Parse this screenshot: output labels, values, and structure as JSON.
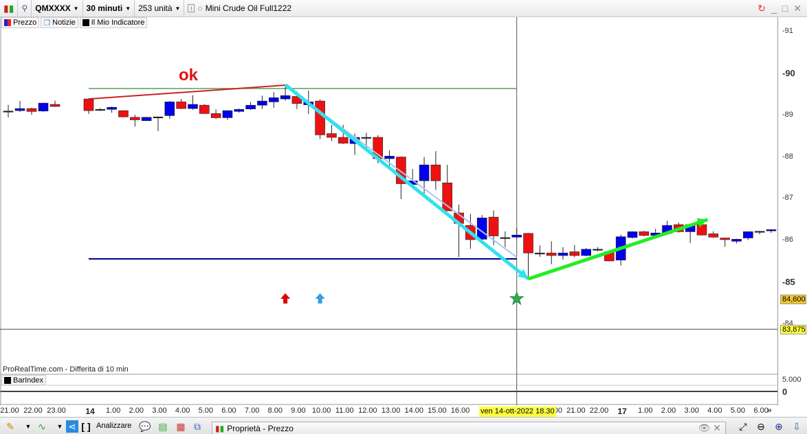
{
  "toolbar": {
    "symbol": "QMXXXX",
    "timeframe": "30 minuti",
    "units": "253 unità",
    "instrument_name": "Mini Crude Oil Full1222",
    "window_controls": [
      "refresh-icon",
      "minimize-icon",
      "maximize-icon",
      "close-icon"
    ]
  },
  "legend": {
    "items": [
      {
        "label": "Prezzo",
        "icon": "price-swatch-icon"
      },
      {
        "label": "Notizie",
        "icon": "news-icon"
      },
      {
        "label": "Il Mio Indicatore",
        "icon": "indicator-swatch-icon"
      }
    ]
  },
  "annotation_text": "ok",
  "source_note": "ProRealTime.com - Differita di 10 min",
  "indicator_panel": {
    "label": "BarIndex",
    "ticks": [
      "5.000",
      "0"
    ]
  },
  "price_axis": {
    "ticks": [
      "91",
      "90",
      "89",
      "88",
      "87",
      "86",
      "85",
      "84"
    ],
    "bold_ticks": [
      "90",
      "85"
    ],
    "last_price_tag": "84,600",
    "cursor_price_tag": "83,875"
  },
  "time_axis": {
    "labels": [
      "21.00",
      "22.00",
      "23.00",
      "14",
      "1.00",
      "2.00",
      "3.00",
      "4.00",
      "5.00",
      "6.00",
      "7.00",
      "8.00",
      "9.00",
      "10.00",
      "11.00",
      "12.00",
      "13.00",
      "14.00",
      "15.00",
      "16.00",
      "17",
      "20.00",
      "21.00",
      "22.00",
      "17",
      "1.00",
      "2.00",
      "3.00",
      "4.00",
      "5.00",
      "6.00"
    ],
    "day_labels": [
      "14",
      "17"
    ],
    "cursor_tooltip": "ven 14-ott-2022 18.30",
    "more": "»"
  },
  "bottom_toolbar": {
    "analyze_label": "Analizzare",
    "properties_panel_title": "Proprietà - Prezzo"
  },
  "colors": {
    "up": "#0000ee",
    "down": "#ee1111",
    "cyan_arrow": "#33e0f0",
    "green_arrow": "#22ee22",
    "support": "#00008b",
    "resistance": "#5aa05a"
  },
  "chart_data": {
    "type": "candlestick",
    "ylim": [
      83.5,
      91.3
    ],
    "candles_ohlc": [
      [
        89.1,
        89.25,
        88.95,
        89.1
      ],
      [
        89.11,
        89.34,
        89.08,
        89.16
      ],
      [
        89.16,
        89.18,
        89.01,
        89.09
      ],
      [
        89.1,
        89.3,
        89.08,
        89.29
      ],
      [
        89.26,
        89.35,
        89.2,
        89.21
      ],
      [
        89.39,
        89.4,
        89.03,
        89.11
      ],
      [
        89.14,
        89.17,
        89.1,
        89.14
      ],
      [
        89.14,
        89.21,
        89.06,
        89.19
      ],
      [
        89.11,
        89.12,
        88.95,
        88.96
      ],
      [
        88.95,
        89.01,
        88.73,
        88.89
      ],
      [
        88.87,
        88.96,
        88.86,
        88.95
      ],
      [
        88.96,
        88.97,
        88.62,
        88.96
      ],
      [
        88.99,
        89.34,
        88.91,
        89.32
      ],
      [
        89.32,
        89.39,
        89.15,
        89.16
      ],
      [
        89.16,
        89.48,
        89.13,
        89.26
      ],
      [
        89.24,
        89.27,
        89.03,
        89.04
      ],
      [
        89.04,
        89.14,
        88.91,
        88.94
      ],
      [
        88.94,
        89.12,
        88.89,
        89.11
      ],
      [
        89.09,
        89.16,
        89.06,
        89.14
      ],
      [
        89.15,
        89.32,
        89.13,
        89.24
      ],
      [
        89.24,
        89.47,
        89.15,
        89.34
      ],
      [
        89.32,
        89.55,
        89.18,
        89.42
      ],
      [
        89.39,
        89.71,
        89.35,
        89.47
      ],
      [
        89.45,
        89.57,
        89.15,
        89.28
      ],
      [
        89.25,
        89.59,
        89.03,
        89.32
      ],
      [
        89.34,
        89.38,
        88.43,
        88.53
      ],
      [
        88.56,
        88.77,
        88.38,
        88.47
      ],
      [
        88.47,
        88.77,
        88.31,
        88.33
      ],
      [
        88.32,
        88.56,
        88.05,
        88.47
      ],
      [
        88.47,
        88.58,
        88.22,
        88.47
      ],
      [
        88.47,
        88.52,
        87.85,
        87.96
      ],
      [
        87.96,
        88.16,
        87.78,
        88.02
      ],
      [
        88.0,
        88.01,
        86.99,
        87.36
      ],
      [
        87.34,
        87.71,
        87.3,
        87.43
      ],
      [
        87.43,
        88.0,
        87.12,
        87.81
      ],
      [
        87.81,
        88.14,
        87.21,
        87.43
      ],
      [
        87.38,
        87.81,
        86.7,
        86.71
      ],
      [
        86.66,
        86.86,
        85.6,
        86.41
      ],
      [
        86.36,
        86.64,
        85.8,
        86.02
      ],
      [
        86.03,
        86.61,
        85.98,
        86.54
      ],
      [
        86.56,
        86.72,
        85.89,
        86.11
      ],
      [
        86.07,
        86.22,
        85.84,
        86.07
      ],
      [
        86.08,
        86.29,
        86.05,
        86.13
      ],
      [
        86.17,
        86.18,
        85.07,
        85.7
      ],
      [
        85.7,
        85.88,
        85.61,
        85.7
      ],
      [
        85.7,
        85.98,
        85.43,
        85.64
      ],
      [
        85.64,
        85.84,
        85.54,
        85.7
      ],
      [
        85.73,
        85.89,
        85.6,
        85.64
      ],
      [
        85.64,
        85.82,
        85.62,
        85.79
      ],
      [
        85.79,
        85.84,
        85.74,
        85.79
      ],
      [
        85.73,
        85.75,
        85.5,
        85.51
      ],
      [
        85.53,
        86.14,
        85.4,
        86.09
      ],
      [
        86.07,
        86.22,
        86.05,
        86.21
      ],
      [
        86.21,
        86.23,
        86.1,
        86.12
      ],
      [
        86.12,
        86.28,
        86.1,
        86.18
      ],
      [
        86.17,
        86.47,
        86.15,
        86.36
      ],
      [
        86.38,
        86.43,
        86.19,
        86.21
      ],
      [
        86.21,
        86.4,
        85.94,
        86.38
      ],
      [
        86.38,
        86.4,
        86.12,
        86.13
      ],
      [
        86.16,
        86.22,
        86.06,
        86.08
      ],
      [
        86.06,
        86.07,
        85.85,
        86.02
      ],
      [
        85.98,
        86.04,
        85.93,
        86.03
      ],
      [
        86.06,
        86.22,
        86.01,
        86.21
      ],
      [
        86.22,
        86.23,
        86.15,
        86.22
      ],
      [
        86.23,
        86.27,
        86.18,
        86.26
      ]
    ],
    "drawings": {
      "resistance_level": 89.64,
      "support_level": 85.56,
      "red_trendline": [
        [
          5,
          89.39
        ],
        [
          22,
          89.72
        ]
      ],
      "cyan_arrow": [
        [
          22,
          89.73
        ],
        [
          43,
          85.08
        ]
      ],
      "light_trendline": [
        [
          22,
          89.7
        ],
        [
          42,
          85.6
        ]
      ],
      "green_arrow": [
        [
          43,
          85.08
        ],
        [
          58.5,
          86.5
        ]
      ],
      "cursor_bar": 42,
      "cursor_price": 83.875,
      "markers": [
        {
          "bar": 22,
          "type": "up-arrow",
          "color": "#dd0000"
        },
        {
          "bar": 25,
          "type": "up-arrow",
          "color": "#33a0e0"
        },
        {
          "bar": 42,
          "type": "star",
          "color": "#33aa44"
        }
      ]
    }
  }
}
